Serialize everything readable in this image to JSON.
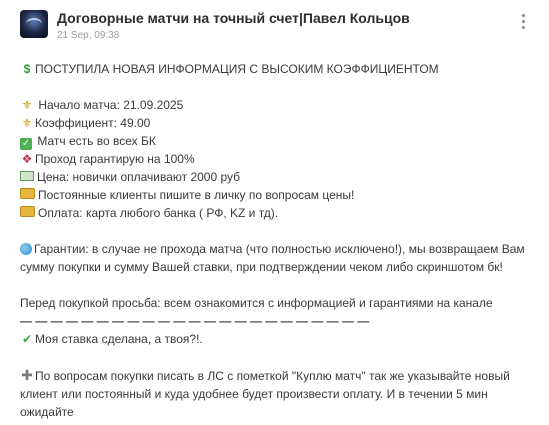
{
  "post": {
    "title": "Договорные матчи на точный счет|Павел Кольцов",
    "date": "21 Sep, 09:38"
  },
  "icons": {
    "avatar": "channel-avatar",
    "menu": "more-vertical-icon"
  },
  "message": {
    "headline": "ПОСТУПИЛА НОВАЯ ИНФОРМАЦИЯ С ВЫСОКИМ КОЭФФИЦИЕНТОМ",
    "start": "Начало матча: 21.09.2025",
    "coef": "Коэффициент: 49.00",
    "bk": "Матч есть во всех БК",
    "guarantee": "Проход гарантирую на 100%",
    "price": "Цена: новички оплачивают 2000 руб",
    "regular": "Постоянные клиенты пишите в личку по вопросам цены!",
    "payment": "Оплата: карта любого банка ( РФ, KZ и тд).",
    "guarantees": "Гарантии: в случае не прохода матча (что полностью исключено!), мы возвращаем Вам сумму покупки и сумму Вашей ставки, при подтверждении чеком либо скриншотом бк!",
    "request": "Перед покупкой просьба: всем ознакомится с информацией и гарантиями на канале",
    "dashes": "— — — — — — — — — — — — — — — — — — — — — — —",
    "bet": "Моя ставка сделана, а твоя?!.",
    "contact": "По вопросам покупки писать в ЛС с пометкой \"Куплю матч\" так же указывайте новый клиент или постоянный и куда удобнее будет произвести оплату. И в течении 5 мин ожидайте"
  }
}
